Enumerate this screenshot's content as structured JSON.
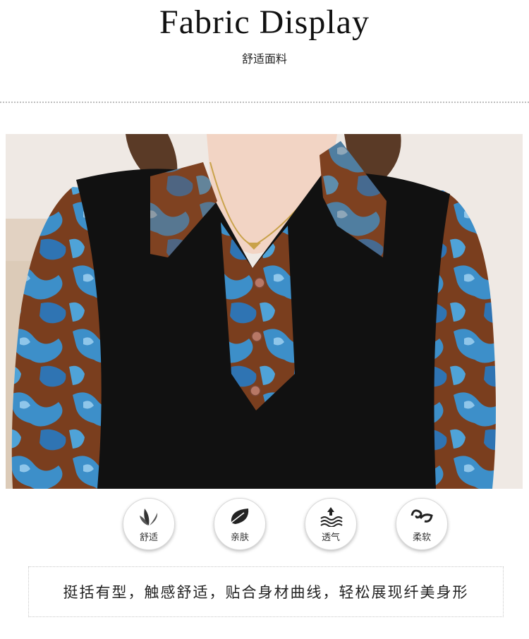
{
  "header": {
    "title": "Fabric  Display",
    "subtitle": "舒适面料"
  },
  "photo": {
    "description_icon": "garment-photo",
    "colors": {
      "background": "#efe9e4",
      "vest": "#111111",
      "print_blue": "#3d8fc9",
      "print_brown": "#7a3e1e",
      "skin": "#f2d4c4",
      "hair": "#5a3a26"
    }
  },
  "features": [
    {
      "icon": "leaves-icon",
      "label": "舒适"
    },
    {
      "icon": "leaf-icon",
      "label": "亲肤"
    },
    {
      "icon": "breathable-waves-icon",
      "label": "透气"
    },
    {
      "icon": "soft-curl-icon",
      "label": "柔软"
    }
  ],
  "description": "挺括有型，触感舒适，贴合身材曲线，轻松展现纤美身形"
}
